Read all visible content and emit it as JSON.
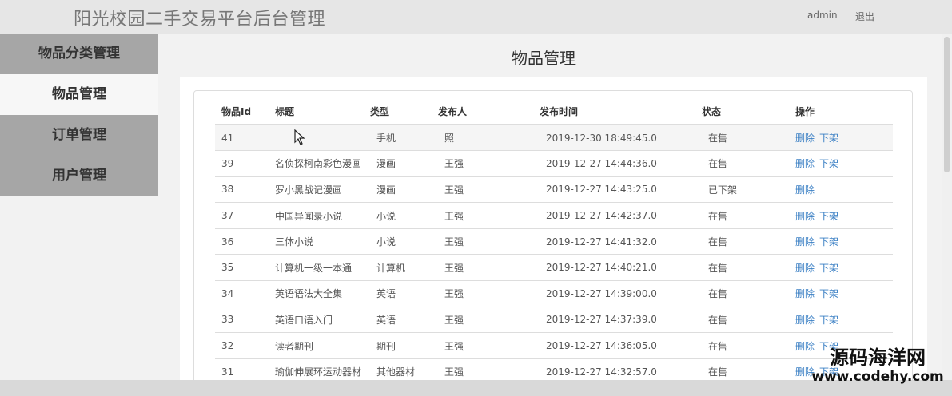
{
  "app": {
    "title": "阳光校园二手交易平台后台管理"
  },
  "top_nav": {
    "user": "admin",
    "logout": "退出"
  },
  "sidebar": {
    "items": [
      {
        "label": "物品分类管理"
      },
      {
        "label": "物品管理"
      },
      {
        "label": "订单管理"
      },
      {
        "label": "用户管理"
      }
    ],
    "active_index": 1
  },
  "main": {
    "title": "物品管理"
  },
  "table": {
    "headers": [
      "物品Id",
      "标题",
      "类型",
      "发布人",
      "发布时间",
      "状态",
      "操作"
    ],
    "rows": [
      {
        "id": "41",
        "title": "",
        "type": "手机",
        "publisher": "照",
        "time": "2019-12-30 18:49:45.0",
        "status": "在售",
        "actions": [
          "删除",
          "下架"
        ]
      },
      {
        "id": "39",
        "title": "名侦探柯南彩色漫画",
        "type": "漫画",
        "publisher": "王强",
        "time": "2019-12-27 14:44:36.0",
        "status": "在售",
        "actions": [
          "删除",
          "下架"
        ]
      },
      {
        "id": "38",
        "title": "罗小黑战记漫画",
        "type": "漫画",
        "publisher": "王强",
        "time": "2019-12-27 14:43:25.0",
        "status": "已下架",
        "actions": [
          "删除",
          ""
        ]
      },
      {
        "id": "37",
        "title": "中国异闻录小说",
        "type": "小说",
        "publisher": "王强",
        "time": "2019-12-27 14:42:37.0",
        "status": "在售",
        "actions": [
          "删除",
          "下架"
        ]
      },
      {
        "id": "36",
        "title": "三体小说",
        "type": "小说",
        "publisher": "王强",
        "time": "2019-12-27 14:41:32.0",
        "status": "在售",
        "actions": [
          "删除",
          "下架"
        ]
      },
      {
        "id": "35",
        "title": "计算机一级一本通",
        "type": "计算机",
        "publisher": "王强",
        "time": "2019-12-27 14:40:21.0",
        "status": "在售",
        "actions": [
          "删除",
          "下架"
        ]
      },
      {
        "id": "34",
        "title": "英语语法大全集",
        "type": "英语",
        "publisher": "王强",
        "time": "2019-12-27 14:39:00.0",
        "status": "在售",
        "actions": [
          "删除",
          "下架"
        ]
      },
      {
        "id": "33",
        "title": "英语口语入门",
        "type": "英语",
        "publisher": "王强",
        "time": "2019-12-27 14:37:39.0",
        "status": "在售",
        "actions": [
          "删除",
          "下架"
        ]
      },
      {
        "id": "32",
        "title": "读者期刊",
        "type": "期刊",
        "publisher": "王强",
        "time": "2019-12-27 14:36:05.0",
        "status": "在售",
        "actions": [
          "删除",
          "下架"
        ]
      },
      {
        "id": "31",
        "title": "瑜伽伸展环运动器材",
        "type": "其他器材",
        "publisher": "王强",
        "time": "2019-12-27 14:32:57.0",
        "status": "在售",
        "actions": [
          "删除",
          "下架"
        ]
      }
    ]
  },
  "watermark": {
    "line1": "源码海洋网",
    "line2": "www.codehy.com"
  },
  "icons": {
    "cursor": "mouse-pointer-icon"
  },
  "colors": {
    "link": "#3a7fc4",
    "sidebar_bg": "#a6a6a6",
    "topbar_bg": "#e6e6e6"
  }
}
